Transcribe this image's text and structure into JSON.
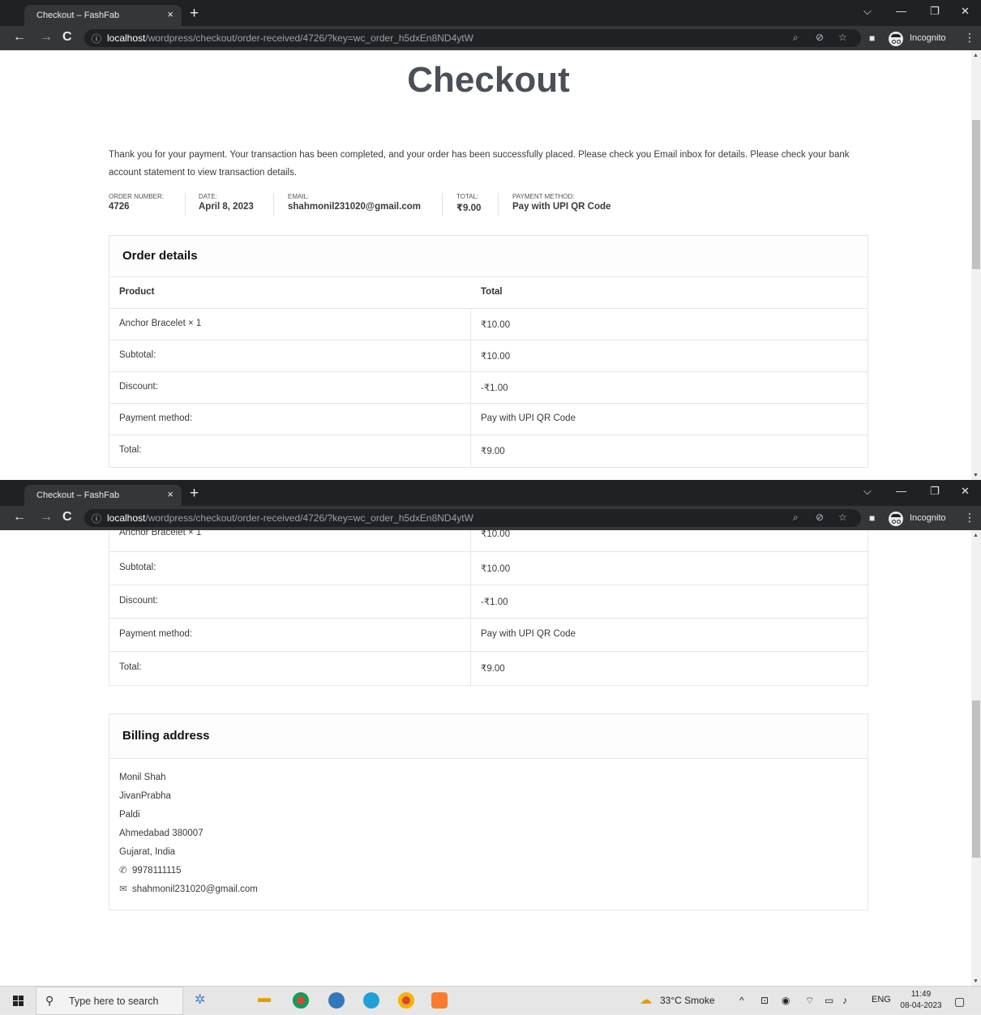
{
  "browser": {
    "tab_title": "Checkout – FashFab",
    "tab_close": "×",
    "new_tab": "+",
    "url_host": "localhost",
    "url_path": "/wordpress/checkout/order-received/4726/?key=wc_order_h5dxEn8ND4ytW",
    "incognito_label": "Incognito"
  },
  "page": {
    "title": "Checkout",
    "thank_you": "Thank you for your payment. Your transaction has been completed, and your order has been successfully placed. Please check you Email inbox for details. Please check your bank account statement to view transaction details.",
    "overview": {
      "order_number_label": "Order number:",
      "order_number": "4726",
      "date_label": "Date:",
      "date": "April 8, 2023",
      "email_label": "Email:",
      "email": "shahmonil231020@gmail.com",
      "total_label": "Total:",
      "total": "₹9.00",
      "payment_label": "Payment method:",
      "payment": "Pay with UPI QR Code"
    },
    "order_details": {
      "heading": "Order details",
      "col_product": "Product",
      "col_total": "Total",
      "rows": [
        {
          "label": "Anchor Bracelet × 1",
          "value": "₹10.00"
        },
        {
          "label": "Subtotal:",
          "value": "₹10.00"
        },
        {
          "label": "Discount:",
          "value": "-₹1.00"
        },
        {
          "label": "Payment method:",
          "value": "Pay with UPI QR Code"
        },
        {
          "label": "Total:",
          "value": "₹9.00"
        }
      ]
    },
    "billing": {
      "heading": "Billing address",
      "lines": [
        "Monil Shah",
        "JivanPrabha",
        "Paldi",
        "Ahmedabad 380007",
        "Gujarat, India"
      ],
      "phone": "9978111115",
      "email": "shahmonil231020@gmail.com"
    }
  },
  "taskbar": {
    "search_placeholder": "Type here to search",
    "weather": "33°C  Smoke",
    "language": "ENG",
    "time": "11:49",
    "date": "08-04-2023"
  }
}
